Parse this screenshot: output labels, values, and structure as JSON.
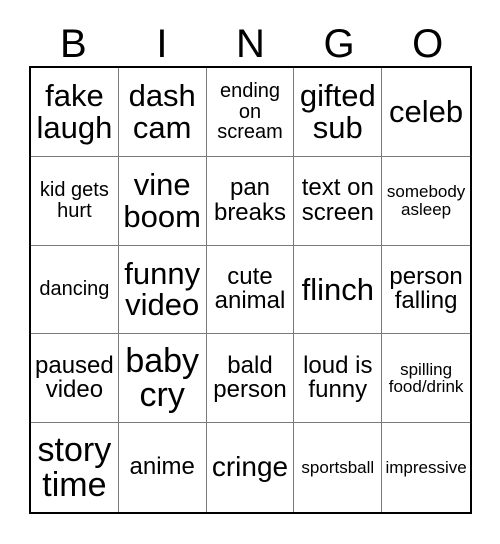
{
  "card": {
    "type": "bingo-card",
    "columns": 5,
    "rows": 5,
    "background_color": "#ffffff",
    "text_color": "#000000",
    "grid_border_color": "#000000",
    "cell_border_color": "#7a7a7a"
  },
  "header": {
    "letters": [
      "B",
      "I",
      "N",
      "G",
      "O"
    ]
  },
  "grid": {
    "cells": [
      {
        "text": "fake laugh",
        "size": "xl"
      },
      {
        "text": "dash cam",
        "size": "xl"
      },
      {
        "text": "ending on scream",
        "size": "s"
      },
      {
        "text": "gifted sub",
        "size": "xl"
      },
      {
        "text": "celeb",
        "size": "xl"
      },
      {
        "text": "kid gets hurt",
        "size": "s"
      },
      {
        "text": "vine boom",
        "size": "xl"
      },
      {
        "text": "pan breaks",
        "size": "m"
      },
      {
        "text": "text on screen",
        "size": "m"
      },
      {
        "text": "somebody asleep",
        "size": "xs"
      },
      {
        "text": "dancing",
        "size": "s"
      },
      {
        "text": "funny video",
        "size": "xl"
      },
      {
        "text": "cute animal",
        "size": "m"
      },
      {
        "text": "flinch",
        "size": "xl"
      },
      {
        "text": "person falling",
        "size": "m"
      },
      {
        "text": "paused video",
        "size": "m"
      },
      {
        "text": "baby cry",
        "size": "xxl"
      },
      {
        "text": "bald person",
        "size": "m"
      },
      {
        "text": "loud is funny",
        "size": "m"
      },
      {
        "text": "spilling food/drink",
        "size": "xs"
      },
      {
        "text": "story time",
        "size": "xxl"
      },
      {
        "text": "anime",
        "size": "m"
      },
      {
        "text": "cringe",
        "size": "l"
      },
      {
        "text": "sportsball",
        "size": "xs"
      },
      {
        "text": "impressive",
        "size": "xs"
      }
    ]
  }
}
